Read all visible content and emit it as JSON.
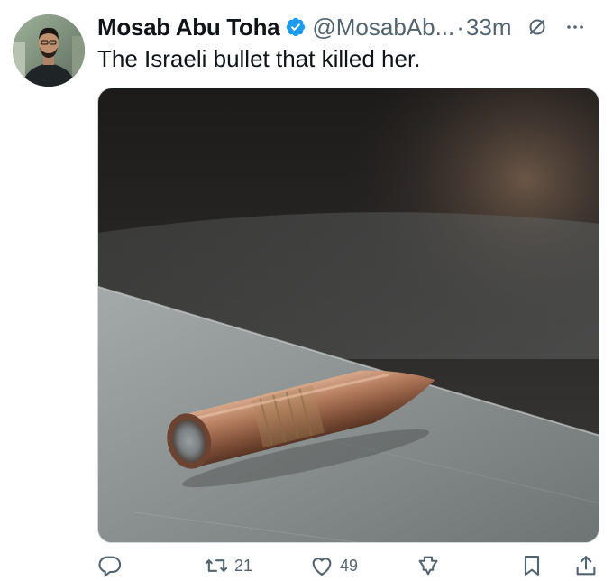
{
  "author": {
    "display_name": "Mosab Abu Toha",
    "handle": "@MosabAb...",
    "separator": "·",
    "timestamp": "33m",
    "verified": true,
    "verified_color": "#1d9bf0"
  },
  "tweet": {
    "text": "The Israeli bullet that killed her."
  },
  "media": {
    "icon": "photo-of-bullet"
  },
  "actions": {
    "reply": {
      "icon": "reply-icon",
      "count": ""
    },
    "retweet": {
      "icon": "retweet-icon",
      "count": "21"
    },
    "like": {
      "icon": "heart-icon",
      "count": "49"
    },
    "views": {
      "icon": "analytics-icon",
      "count": ""
    },
    "bookmark": {
      "icon": "bookmark-icon",
      "count": ""
    },
    "share": {
      "icon": "share-icon",
      "count": ""
    }
  },
  "colors": {
    "text_primary": "#0f1419",
    "text_secondary": "#536471",
    "accent": "#1d9bf0"
  }
}
